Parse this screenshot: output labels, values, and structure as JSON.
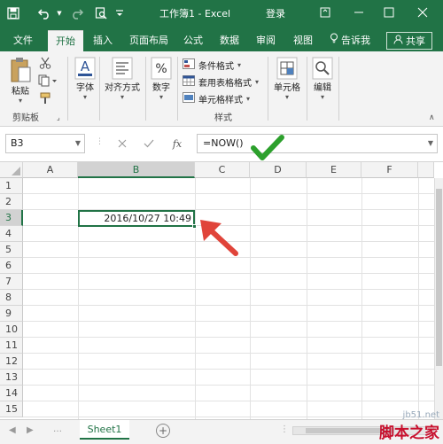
{
  "titlebar": {
    "title": "工作簿1 - Excel",
    "login": "登录",
    "bg": "#217346"
  },
  "tabs": {
    "items": [
      {
        "label": "文件",
        "active": false
      },
      {
        "label": "开始",
        "active": true
      },
      {
        "label": "插入",
        "active": false
      },
      {
        "label": "页面布局",
        "active": false
      },
      {
        "label": "公式",
        "active": false
      },
      {
        "label": "数据",
        "active": false
      },
      {
        "label": "审阅",
        "active": false
      },
      {
        "label": "视图",
        "active": false
      }
    ],
    "tellme": "告诉我",
    "share": "共享"
  },
  "ribbon": {
    "clipboard": {
      "paste": "粘贴",
      "group": "剪贴板"
    },
    "font": "字体",
    "alignment": "对齐方式",
    "number": "数字",
    "styles": {
      "conditional": "条件格式",
      "table": "套用表格格式",
      "cell": "单元格样式",
      "group": "样式"
    },
    "cells": "单元格",
    "editing": "编辑"
  },
  "formula_bar": {
    "namebox": "B3",
    "fx": "fx",
    "formula": "=NOW()"
  },
  "grid": {
    "columns": [
      "A",
      "B",
      "C",
      "D",
      "E",
      "F"
    ],
    "selected_column": "B",
    "rows": [
      "1",
      "2",
      "3",
      "4",
      "5",
      "6",
      "7",
      "8",
      "9",
      "10",
      "11",
      "12",
      "13",
      "14",
      "15"
    ],
    "selected_row": "3",
    "active_cell": {
      "ref": "B3",
      "value": "2016/10/27 10:49"
    }
  },
  "sheets": {
    "tabs": [
      "Sheet1"
    ],
    "active": "Sheet1"
  },
  "watermark": {
    "url": "jb51.net",
    "brand": "脚本之家"
  },
  "colors": {
    "accent": "#217346",
    "arrow": "#e0443a",
    "check": "#2ca02c"
  }
}
